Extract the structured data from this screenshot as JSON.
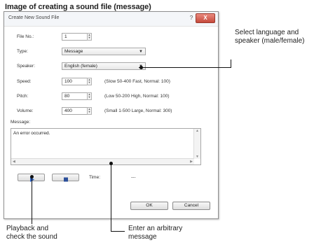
{
  "heading": "Image of creating a sound file (message)",
  "dialog": {
    "title": "Create New Sound File",
    "help_icon": "?",
    "close_icon": "X",
    "fields": {
      "file_no": {
        "label": "File No.:",
        "value": "1"
      },
      "type": {
        "label": "Type:",
        "value": "Message"
      },
      "speaker": {
        "label": "Speaker:",
        "value": "English (female)"
      },
      "speed": {
        "label": "Speed:",
        "value": "100",
        "hint": "(Slow 50-400 Fast, Normal: 100)"
      },
      "pitch": {
        "label": "Pitch:",
        "value": "80",
        "hint": "(Low 50-200 High, Normal: 100)"
      },
      "volume": {
        "label": "Volume:",
        "value": "400",
        "hint": "(Small 1-500 Large, Normal: 300)"
      }
    },
    "message": {
      "label": "Message:",
      "value": "An error occurred."
    },
    "time": {
      "label": "Time:",
      "value": "---"
    },
    "ok": "OK",
    "cancel": "Cancel"
  },
  "callouts": {
    "speaker_note": "Select language and\nspeaker (male/female)",
    "playback_note": "Playback and\ncheck the sound",
    "message_note": "Enter an arbitrary\nmessage"
  },
  "colors": {
    "play_icon": "#2b63c7",
    "stop_icon": "#2b4f9a",
    "close_button": "#c64a3c"
  }
}
